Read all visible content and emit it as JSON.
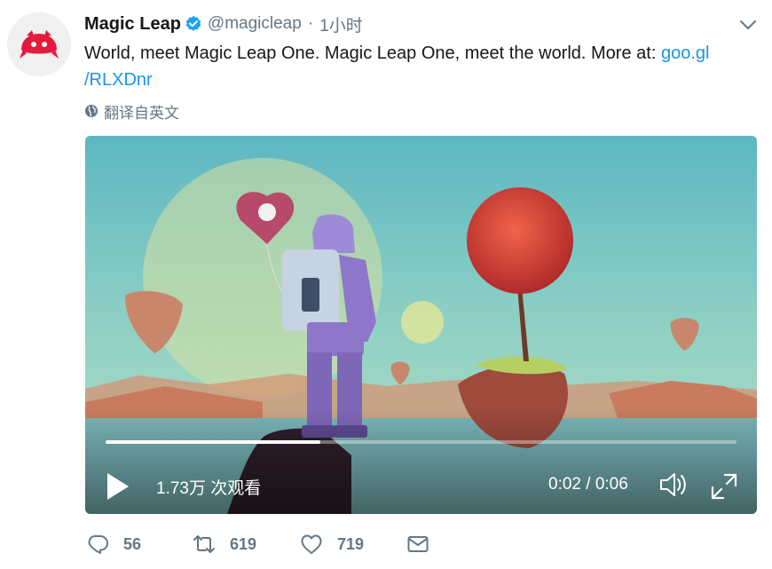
{
  "tweet": {
    "author_name": "Magic Leap",
    "handle": "@magicleap",
    "separator": "·",
    "time": "1小时",
    "text_prefix": "World, meet Magic Leap One. Magic Leap One, meet the world. More at: ",
    "link_line1": "goo.gl",
    "link_line2": "/RLXDnr",
    "translate_label": "翻译自英文",
    "icons": {
      "avatar": "magic-leap-logo",
      "verified": "verified-badge-icon",
      "caret": "chevron-down-icon",
      "translate": "globe-icon"
    }
  },
  "video": {
    "progress": 0.34,
    "views": "1.73万 次观看",
    "timecode": "0:02 / 0:06",
    "icons": {
      "play": "play-icon",
      "volume": "volume-icon",
      "fullscreen": "fullscreen-icon"
    }
  },
  "actions": {
    "reply_count": "56",
    "retweet_count": "619",
    "like_count": "719",
    "icons": {
      "reply": "reply-icon",
      "retweet": "retweet-icon",
      "like": "heart-icon",
      "dm": "envelope-icon"
    }
  },
  "colors": {
    "link": "#1b95e0",
    "verified": "#1da1f2",
    "muted": "#657786",
    "brand_logo": "#e5193c"
  }
}
